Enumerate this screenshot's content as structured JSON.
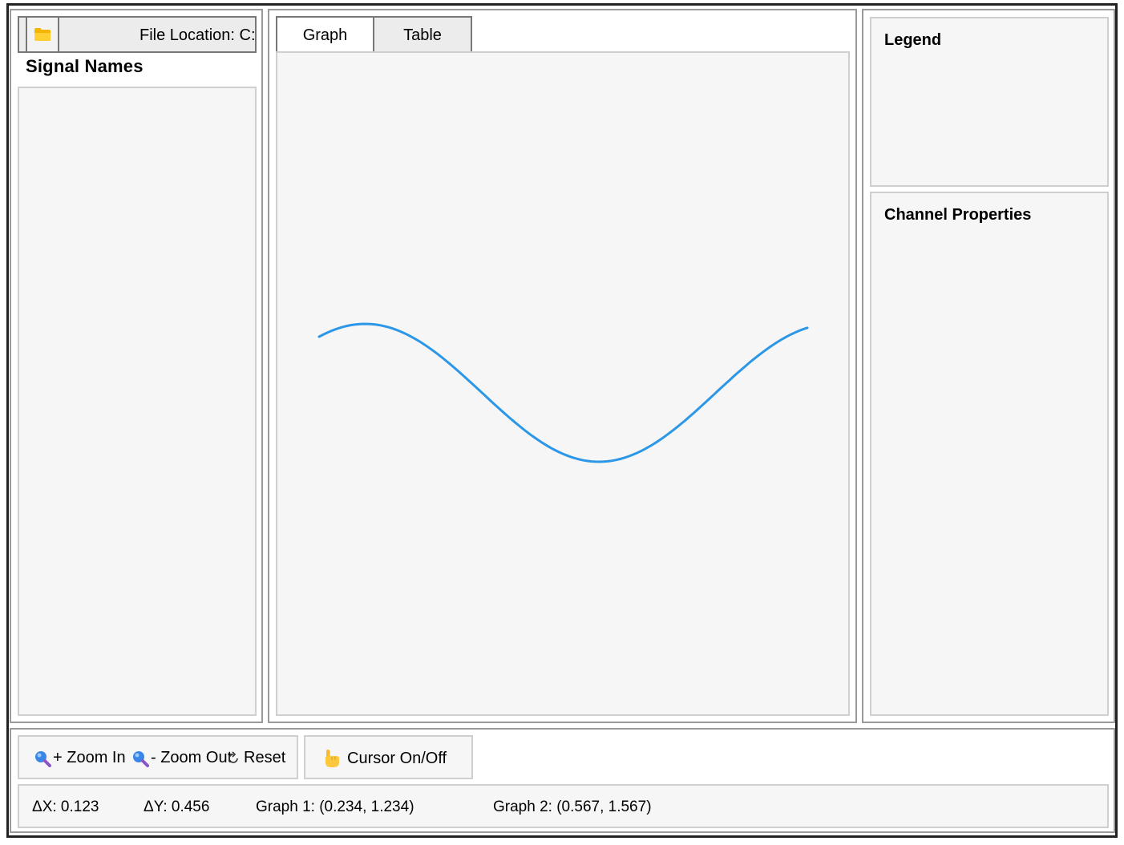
{
  "file_bar": {
    "folder_icon": "folder-icon",
    "location_text": "File Location: C:/..."
  },
  "signals": {
    "title": "Signal Names",
    "items": []
  },
  "tabs": [
    {
      "label": "Graph",
      "active": true
    },
    {
      "label": "Table",
      "active": false
    }
  ],
  "graph": {
    "line_color": "#2b97e6",
    "shape": "sine"
  },
  "legend": {
    "title": "Legend"
  },
  "channel_properties": {
    "title": "Channel Properties"
  },
  "toolbar": {
    "zoom_in_label": "+ Zoom In",
    "zoom_out_label": "- Zoom Out",
    "reset_label": "Reset",
    "cursor_label": "Cursor On/Off",
    "zoom_icon": "magnifier-icon",
    "reset_icon": "reset-icon",
    "cursor_icon": "pointing-hand-icon"
  },
  "status": {
    "dx": "ΔX: 0.123",
    "dy": "ΔY: 0.456",
    "graph1": "Graph 1: (0.234, 1.234)",
    "graph2": "Graph 2: (0.567, 1.567)"
  }
}
